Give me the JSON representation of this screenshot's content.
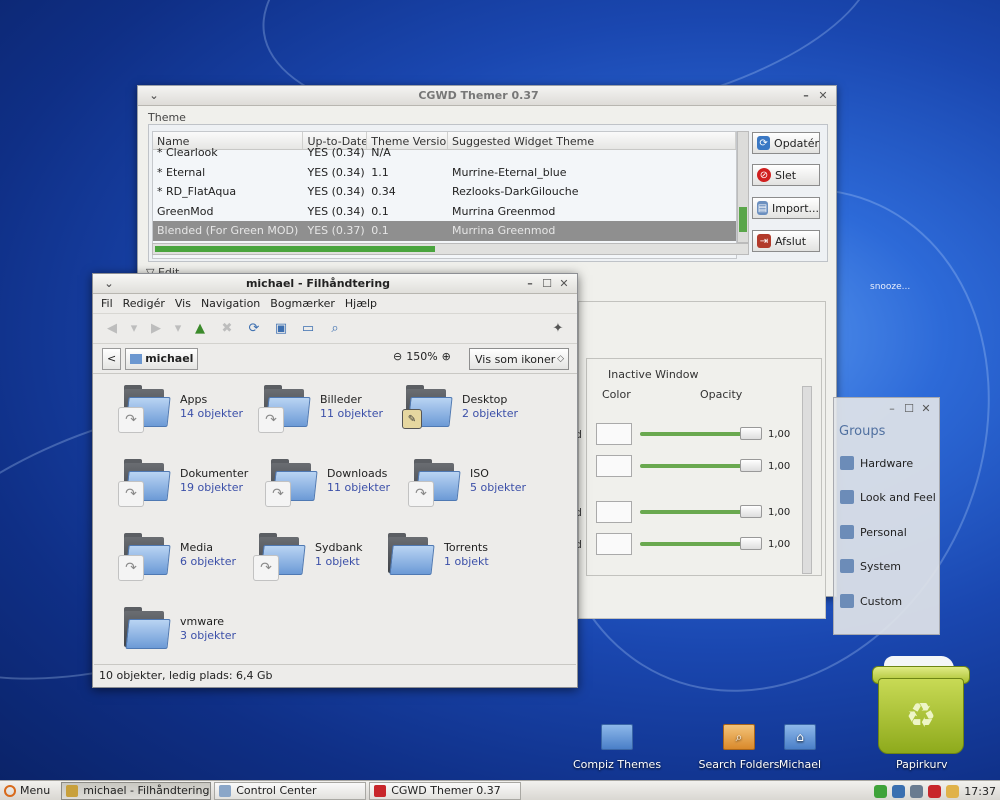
{
  "desktop": {
    "snooze": "snooze..."
  },
  "cgwd": {
    "title": "CGWD Themer 0.37",
    "theme_label": "Theme",
    "columns": [
      "Name",
      "Up-to-Date",
      "Theme Version",
      "Suggested Widget Theme"
    ],
    "rows": [
      [
        "* Clearlook",
        "YES (0.34)",
        "N/A",
        ""
      ],
      [
        "* Eternal",
        "YES (0.34)",
        "1.1",
        "Murrine-Eternal_blue"
      ],
      [
        "* RD_FlatAqua",
        "YES (0.34)",
        "0.34",
        "Rezlooks-DarkGilouche"
      ],
      [
        "GreenMod",
        "YES (0.34)",
        "0.1",
        "Murrina Greenmod"
      ],
      [
        "Blended (For Green MOD)",
        "YES (0.37)",
        "0.1",
        "Murrina Greenmod"
      ]
    ],
    "selected_row": 4,
    "buttons": {
      "update": "Opdatér",
      "delete": "Slet",
      "import": "Import...",
      "quit": "Afslut"
    },
    "edit_expander": "Edit",
    "inactive_window": "Inactive Window",
    "color_header": "Color",
    "opacity_header": "Opacity",
    "row_labels": [
      "nd",
      "d",
      "nd",
      "nd"
    ],
    "opacity_values": [
      "1,00",
      "1,00",
      "1,00",
      "1,00"
    ]
  },
  "control_center": {
    "title": "Control Center",
    "groups_title": "Groups",
    "items": [
      "Hardware",
      "Look and Feel",
      "Personal",
      "System",
      "Custom"
    ]
  },
  "filemanager": {
    "title": "michael - Filhåndtering",
    "menu": [
      "Fil",
      "Redigér",
      "Vis",
      "Navigation",
      "Bogmærker",
      "Hjælp"
    ],
    "location": "michael",
    "zoom": "150%",
    "view_mode": "Vis som ikoner",
    "folders": [
      {
        "name": "Apps",
        "count": "14 objekter",
        "emblem": "link"
      },
      {
        "name": "Billeder",
        "count": "11 objekter",
        "emblem": "link"
      },
      {
        "name": "Desktop",
        "count": "2 objekter",
        "emblem": "desktop"
      },
      {
        "name": "Dokumenter",
        "count": "19 objekter",
        "emblem": "link"
      },
      {
        "name": "Downloads",
        "count": "11 objekter",
        "emblem": "link"
      },
      {
        "name": "ISO",
        "count": "5 objekter",
        "emblem": "link"
      },
      {
        "name": "Media",
        "count": "6 objekter",
        "emblem": "link"
      },
      {
        "name": "Sydbank",
        "count": "1 objekt",
        "emblem": "link"
      },
      {
        "name": "Torrents",
        "count": "1 objekt",
        "emblem": "none"
      },
      {
        "name": "vmware",
        "count": "3 objekter",
        "emblem": "none"
      }
    ],
    "status": "10 objekter, ledig plads: 6,4 Gb"
  },
  "desktop_icons": {
    "compiz": "Compiz Themes",
    "search": "Search Folders",
    "michael": "Michael",
    "trash": "Papirkurv"
  },
  "panel": {
    "menu": "Menu",
    "tasks": [
      "michael - Filhåndtering",
      "Control Center",
      "CGWD Themer 0.37"
    ],
    "active_task": 0,
    "clock": "17:37"
  },
  "colors": {
    "selection": "#8f8f8f",
    "accent_green": "#49a43e",
    "link_blue": "#3b4fa8"
  }
}
